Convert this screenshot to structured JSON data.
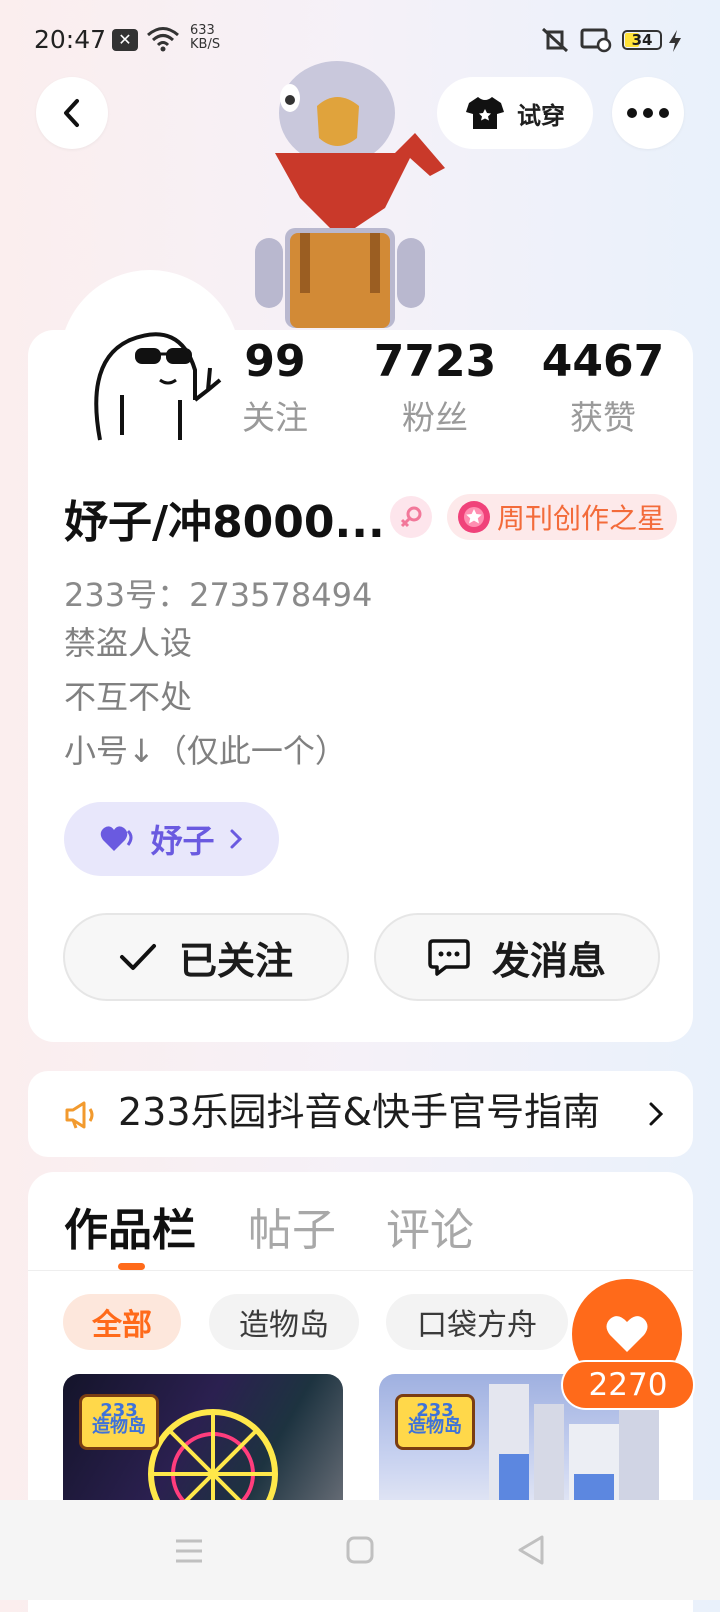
{
  "status_bar": {
    "time": "20:47",
    "net_speed_value": "633",
    "net_speed_unit": "KB/S",
    "battery": "34"
  },
  "header": {
    "try_on_label": "试穿"
  },
  "profile": {
    "stats": [
      {
        "value": "99",
        "label": "关注"
      },
      {
        "value": "7723",
        "label": "粉丝"
      },
      {
        "value": "4467",
        "label": "获赞"
      }
    ],
    "name": "妤子/冲8000...",
    "badge_label": "周刊创作之星",
    "account_id": "233号：273578494",
    "bio": [
      "禁盗人设",
      "不互不处",
      "小号↓（仅此一个）"
    ],
    "linked_account": "妤子",
    "follow_button": "已关注",
    "message_button": "发消息"
  },
  "notice": {
    "text": "233乐园抖音&快手官号指南"
  },
  "works": {
    "tabs": [
      "作品栏",
      "帖子",
      "评论"
    ],
    "filters": [
      "全部",
      "造物岛",
      "口袋方舟"
    ],
    "thumb_tag": [
      "233",
      "造物岛"
    ],
    "like_count": "2270"
  },
  "colors": {
    "accent": "#ff6a1a",
    "purple": "#6a5ae0",
    "badge": "#f36b3a"
  }
}
